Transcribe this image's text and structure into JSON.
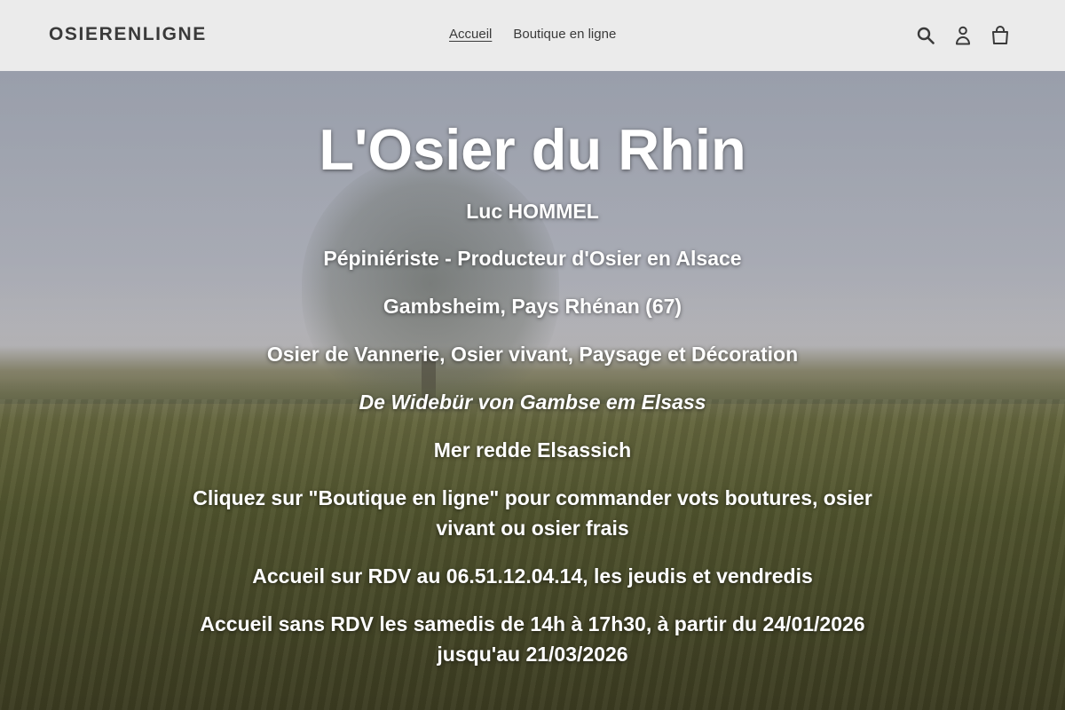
{
  "header": {
    "logo": "OSIERENLIGNE",
    "nav": [
      {
        "label": "Accueil",
        "active": true
      },
      {
        "label": "Boutique en ligne",
        "active": false
      }
    ],
    "icons": [
      "search-icon",
      "account-icon",
      "cart-icon"
    ]
  },
  "hero": {
    "title": "L'Osier du Rhin",
    "lines": [
      "Luc HOMMEL",
      "Pépiniériste - Producteur d'Osier en Alsace",
      "Gambsheim, Pays Rhénan (67)",
      "Osier de Vannerie, Osier vivant, Paysage et Décoration",
      "De Widebür von Gambse em Elsass",
      "Mer redde Elsassich",
      "Cliquez sur \"Boutique en ligne\" pour commander vots boutures, osier vivant ou osier frais",
      "Accueil sur RDV au 06.51.12.04.14, les jeudis et vendredis",
      "Accueil sans RDV les samedis de 14h à 17h30, à partir du 24/01/2026 jusqu'au 21/03/2026"
    ]
  },
  "colors": {
    "header_bg": "#ebebeb",
    "text": "#3a3a3a",
    "hero_text": "#ffffff"
  }
}
